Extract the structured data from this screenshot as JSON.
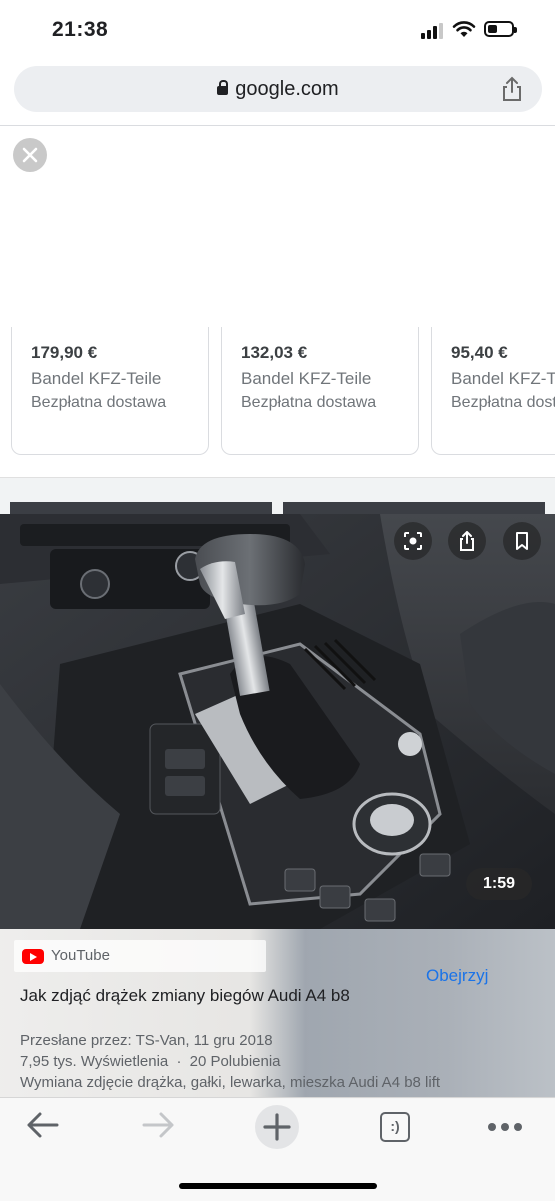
{
  "status_bar": {
    "time": "21:38"
  },
  "browser": {
    "url": "google.com"
  },
  "products": [
    {
      "price": "179,90 €",
      "seller": "Bandel KFZ-Teile",
      "shipping": "Bezpłatna dostawa"
    },
    {
      "price": "132,03 €",
      "seller": "Bandel KFZ-Teile",
      "shipping": "Bezpłatna dostawa"
    },
    {
      "price": "95,40 €",
      "seller": "Bandel KFZ-Teile",
      "shipping": "Bezpłatna dostawa"
    }
  ],
  "video": {
    "duration": "1:59",
    "source": "YouTube",
    "watch_label": "Obejrzyj",
    "title": "Jak zdjąć drążek zmiany biegów Audi A4 b8",
    "uploaded": "Przesłane przez: TS-Van, 11 gru 2018",
    "views": "7,95 tys. Wyświetlenia",
    "separator": "·",
    "likes": "20 Polubienia",
    "description": "Wymiana zdjęcie drążka, gałki, lewarka, mieszka Audi A4 b8 lift"
  },
  "toolbar": {
    "tab_count": ":)"
  },
  "icons": [
    "lock-icon",
    "share-icon",
    "close-icon",
    "lens-icon",
    "share-icon",
    "bookmark-icon",
    "back-arrow-icon",
    "forward-arrow-icon",
    "plus-icon",
    "tabs-icon",
    "more-icon"
  ],
  "colors": {
    "link": "#1a73e8",
    "youtube_red": "#ff0000",
    "url_bar": "#eceef1"
  }
}
